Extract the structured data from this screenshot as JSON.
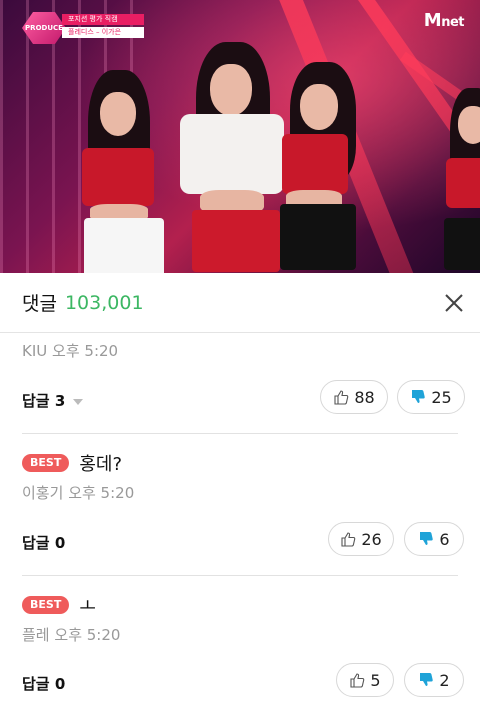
{
  "video": {
    "program_logo_line1": "포지션 평가 직캠",
    "program_logo_line2": "플레디스 – 이가은",
    "program_logo_badge": "PRODUCE 48",
    "channel_logo_m": "M",
    "channel_logo_net": "net"
  },
  "header": {
    "title": "댓글",
    "count": "103,001",
    "close_icon": "close-icon"
  },
  "comments": [
    {
      "best": false,
      "author": "KIU",
      "time": "오후 5:20",
      "text": "",
      "reply_label": "답글 3",
      "has_reply_caret": true,
      "likes": "88",
      "dislikes": "25"
    },
    {
      "best": true,
      "best_label": "BEST",
      "author": "이홍기",
      "time": "오후 5:20",
      "text": "홍데?",
      "reply_label": "답글 0",
      "has_reply_caret": false,
      "likes": "26",
      "dislikes": "6"
    },
    {
      "best": true,
      "best_label": "BEST",
      "author": "플레",
      "time": "오후 5:20",
      "text": "ㅗ",
      "reply_label": "답글 0",
      "has_reply_caret": false,
      "likes": "5",
      "dislikes": "2"
    }
  ],
  "colors": {
    "count_green": "#3cb763",
    "best_red": "#ef5b5b",
    "dislike_blue": "#1fa3d8"
  }
}
